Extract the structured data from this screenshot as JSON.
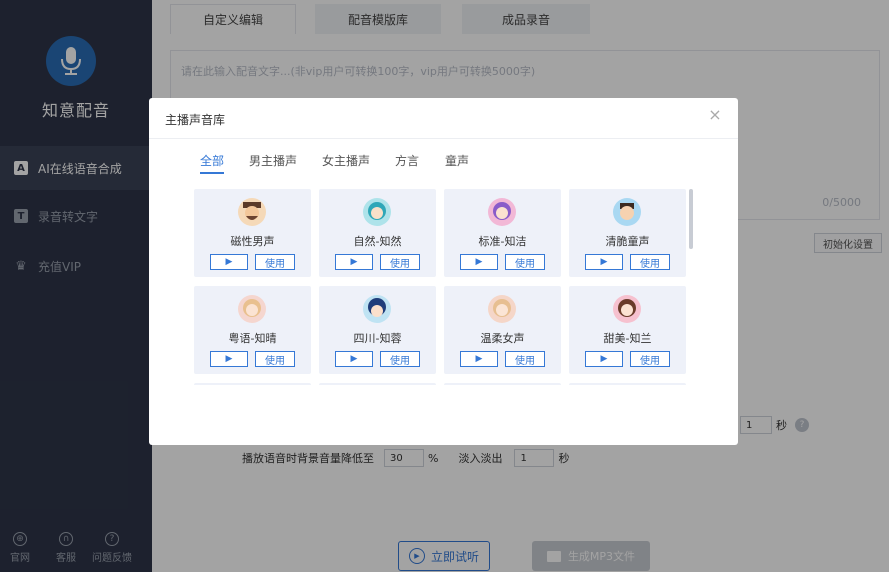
{
  "app": {
    "name": "知意配音"
  },
  "sidebar": {
    "items": [
      {
        "label": "AI在线语音合成",
        "icon": "A"
      },
      {
        "label": "录音转文字",
        "icon": "T"
      },
      {
        "label": "充值VIP",
        "icon": "♛"
      }
    ],
    "bottom": [
      {
        "label": "官网",
        "icon": "⊕"
      },
      {
        "label": "客服",
        "icon": "∩"
      },
      {
        "label": "问题反馈",
        "icon": "?"
      }
    ]
  },
  "tabs": [
    "自定义编辑",
    "配音模版库",
    "成品录音"
  ],
  "editor": {
    "placeholder": "请在此输入配音文字...(非vip用户可转换100字，vip用户可转换5000字)",
    "count": "0/5000"
  },
  "init_button": "初始化设置",
  "settings": {
    "duck_label": "播放语音时背景音量降低至",
    "duck_value": "30",
    "duck_unit": "%",
    "fade_label": "淡入淡出",
    "fade_value": "1",
    "fade_unit": "秒",
    "gap_value": "1",
    "gap_unit": "秒"
  },
  "actions": {
    "trial": "立即试听",
    "generate": "生成MP3文件"
  },
  "modal": {
    "title": "主播声音库",
    "close": "×",
    "filters": [
      "全部",
      "男主播声",
      "女主播声",
      "方言",
      "童声"
    ],
    "voices": [
      {
        "name": "磁性男声",
        "play": "▶",
        "use": "使用"
      },
      {
        "name": "自然-知然",
        "play": "▶",
        "use": "使用"
      },
      {
        "name": "标准-知洁",
        "play": "▶",
        "use": "使用"
      },
      {
        "name": "清脆童声",
        "play": "▶",
        "use": "使用"
      },
      {
        "name": "粤语-知晴",
        "play": "▶",
        "use": "使用"
      },
      {
        "name": "四川-知蓉",
        "play": "▶",
        "use": "使用"
      },
      {
        "name": "温柔女声",
        "play": "▶",
        "use": "使用"
      },
      {
        "name": "甜美-知兰",
        "play": "▶",
        "use": "使用"
      }
    ]
  },
  "colors": {
    "accent": "#3578d6",
    "sidebar": "#2e3548",
    "card": "#eef1f9"
  }
}
